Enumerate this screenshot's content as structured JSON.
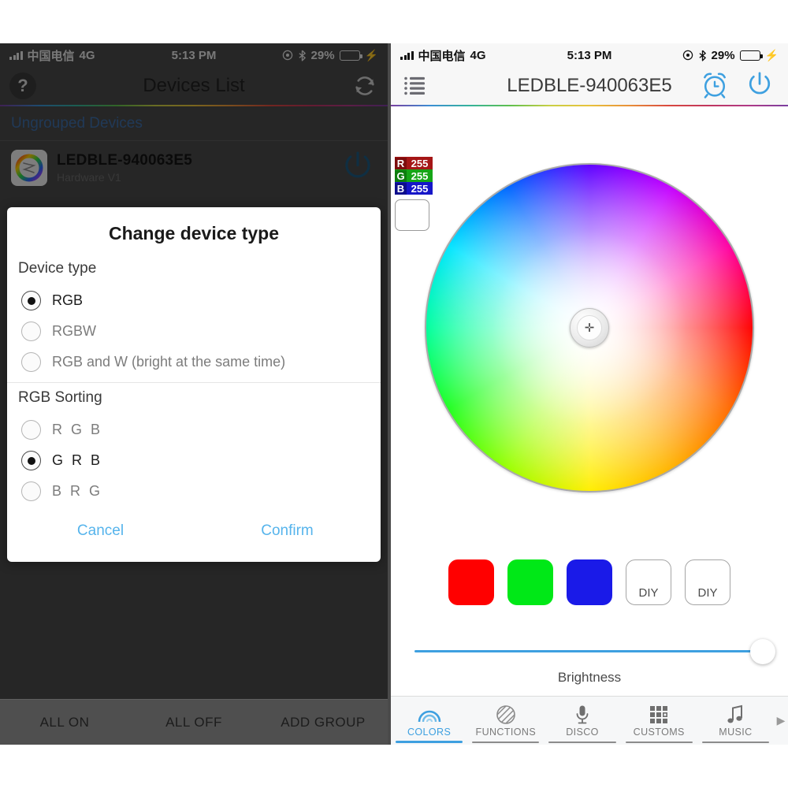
{
  "status_bar": {
    "carrier": "中国电信",
    "network": "4G",
    "time": "5:13 PM",
    "battery_percent": "29%",
    "battery_level": 29,
    "charging": true,
    "icons": [
      "signal-bars-icon",
      "location-icon",
      "bluetooth-icon",
      "battery-icon",
      "charging-bolt-icon"
    ]
  },
  "left_screen": {
    "nav": {
      "help_label": "?",
      "title": "Devices List",
      "refresh_icon": "refresh-icon"
    },
    "group_header": "Ungrouped Devices",
    "device": {
      "name": "LEDBLE-940063E5",
      "hardware": "Hardware V1",
      "power_icon": "power-icon"
    },
    "bottom_actions": [
      {
        "label": "ALL ON"
      },
      {
        "label": "ALL OFF"
      },
      {
        "label": "ADD GROUP"
      }
    ]
  },
  "dialog": {
    "title": "Change device type",
    "device_type": {
      "label": "Device type",
      "options": [
        {
          "label": "RGB",
          "selected": true
        },
        {
          "label": "RGBW",
          "selected": false
        },
        {
          "label": "RGB and W (bright at the same time)",
          "selected": false
        }
      ]
    },
    "rgb_sorting": {
      "label": "RGB Sorting",
      "options": [
        {
          "label": "R G B",
          "selected": false
        },
        {
          "label": "G R B",
          "selected": true
        },
        {
          "label": "B R G",
          "selected": false
        }
      ]
    },
    "cancel_label": "Cancel",
    "confirm_label": "Confirm",
    "accent_color": "#56b4ec"
  },
  "right_screen": {
    "nav": {
      "menu_icon": "list-menu-icon",
      "title": "LEDBLE-940063E5",
      "timer_icon": "alarm-clock-icon",
      "power_icon": "power-icon",
      "icon_color": "#3ea0e0"
    },
    "rgb_readout": {
      "r_channel": "R",
      "r_value": "255",
      "g_channel": "G",
      "g_value": "255",
      "b_channel": "B",
      "b_value": "255",
      "preview_color": "#ffffff"
    },
    "color_wheel": {
      "name": "color-wheel",
      "cursor_position": "center",
      "cursor_glyph": "✛"
    },
    "swatches": [
      {
        "name": "red-swatch",
        "color": "#ff0000",
        "label": ""
      },
      {
        "name": "green-swatch",
        "color": "#00e817",
        "label": ""
      },
      {
        "name": "blue-swatch",
        "color": "#1a1ae8",
        "label": ""
      },
      {
        "name": "diy-swatch-1",
        "color": "#ffffff",
        "label": "DIY"
      },
      {
        "name": "diy-swatch-2",
        "color": "#ffffff",
        "label": "DIY"
      }
    ],
    "brightness": {
      "label": "Brightness",
      "value": 100,
      "track_color": "#3ea0e0"
    },
    "tabs": [
      {
        "label": "COLORS",
        "icon": "rainbow-arc-icon",
        "active": true
      },
      {
        "label": "FUNCTIONS",
        "icon": "striped-circle-icon",
        "active": false
      },
      {
        "label": "DISCO",
        "icon": "microphone-icon",
        "active": false
      },
      {
        "label": "CUSTOMS",
        "icon": "grid-icon",
        "active": false
      },
      {
        "label": "MUSIC",
        "icon": "music-note-icon",
        "active": false
      }
    ],
    "tab_more_icon": "chevron-right-icon"
  }
}
